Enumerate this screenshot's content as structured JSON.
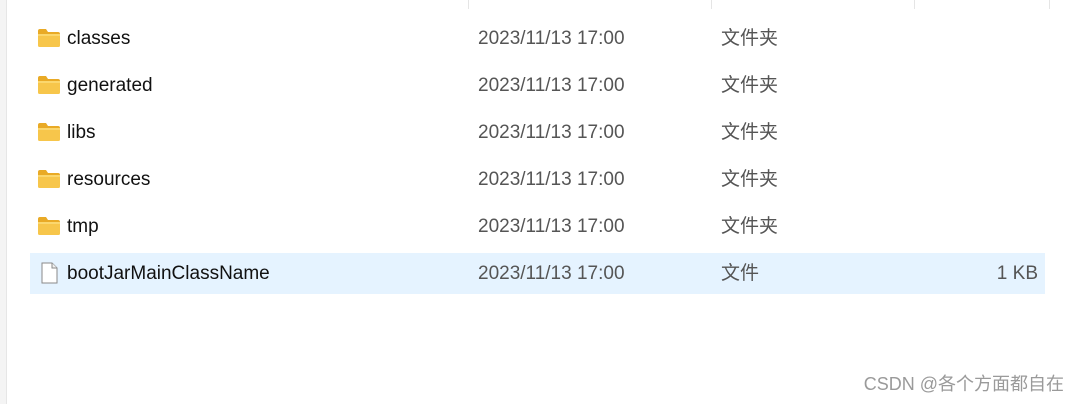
{
  "files": [
    {
      "name": "classes",
      "modified": "2023/11/13 17:00",
      "type": "文件夹",
      "size": "",
      "icon": "folder-icon"
    },
    {
      "name": "generated",
      "modified": "2023/11/13 17:00",
      "type": "文件夹",
      "size": "",
      "icon": "folder-icon"
    },
    {
      "name": "libs",
      "modified": "2023/11/13 17:00",
      "type": "文件夹",
      "size": "",
      "icon": "folder-icon"
    },
    {
      "name": "resources",
      "modified": "2023/11/13 17:00",
      "type": "文件夹",
      "size": "",
      "icon": "folder-icon"
    },
    {
      "name": "tmp",
      "modified": "2023/11/13 17:00",
      "type": "文件夹",
      "size": "",
      "icon": "folder-icon"
    },
    {
      "name": "bootJarMainClassName",
      "modified": "2023/11/13 17:00",
      "type": "文件",
      "size": "1 KB",
      "icon": "file-icon"
    }
  ],
  "selected_index": 5,
  "colors": {
    "selection": "#e5f3ff",
    "folder_body": "#f7c64b",
    "folder_tab": "#e9aa26"
  },
  "watermark": "CSDN @各个方面都自在"
}
